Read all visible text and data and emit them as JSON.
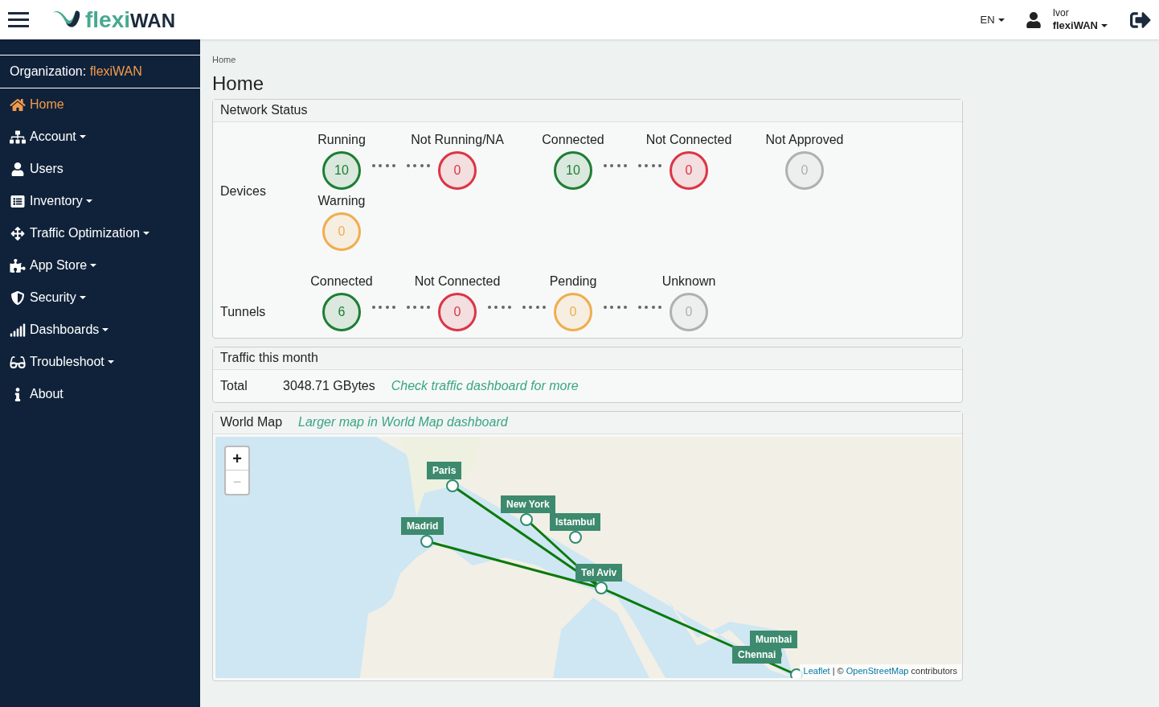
{
  "header": {
    "logo": {
      "part1": "flexi",
      "part2": "WAN"
    },
    "language": "EN",
    "user": {
      "name": "Ivor",
      "organization": "flexiWAN"
    }
  },
  "sidebar": {
    "organization_label": "Organization:",
    "organization": "flexiWAN",
    "items": [
      {
        "label": "Home",
        "selected": true,
        "dropdown": false
      },
      {
        "label": "Account",
        "selected": false,
        "dropdown": true
      },
      {
        "label": "Users",
        "selected": false,
        "dropdown": false
      },
      {
        "label": "Inventory",
        "selected": false,
        "dropdown": true
      },
      {
        "label": "Traffic Optimization",
        "selected": false,
        "dropdown": true
      },
      {
        "label": "App Store",
        "selected": false,
        "dropdown": true
      },
      {
        "label": "Security",
        "selected": false,
        "dropdown": true
      },
      {
        "label": "Dashboards",
        "selected": false,
        "dropdown": true
      },
      {
        "label": "Troubleshoot",
        "selected": false,
        "dropdown": true
      },
      {
        "label": "About",
        "selected": false,
        "dropdown": false
      }
    ]
  },
  "breadcrumb": "Home",
  "page_title": "Home",
  "network_status": {
    "title": "Network Status",
    "groups": [
      {
        "label": "Devices",
        "items": [
          {
            "label": "Running",
            "value": "10",
            "color": "#1e7e34",
            "link_next": true
          },
          {
            "label": "Not Running/NA",
            "value": "0",
            "color": "#dc3545",
            "link_next": false
          },
          {
            "label": "Connected",
            "value": "10",
            "color": "#1e7e34",
            "link_next": true
          },
          {
            "label": "Not Connected",
            "value": "0",
            "color": "#dc3545",
            "link_next": false
          },
          {
            "label": "Not Approved",
            "value": "0",
            "color": "#b0b0b0",
            "link_next": false
          },
          {
            "label": "Warning",
            "value": "0",
            "color": "#f0ad4e",
            "link_next": false
          }
        ]
      },
      {
        "label": "Tunnels",
        "items": [
          {
            "label": "Connected",
            "value": "6",
            "color": "#1e7e34",
            "link_next": true
          },
          {
            "label": "Not Connected",
            "value": "0",
            "color": "#dc3545",
            "link_next": true
          },
          {
            "label": "Pending",
            "value": "0",
            "color": "#f0ad4e",
            "link_next": true
          },
          {
            "label": "Unknown",
            "value": "0",
            "color": "#b0b0b0",
            "link_next": false
          }
        ]
      }
    ]
  },
  "traffic": {
    "title": "Traffic this month",
    "label": "Total",
    "value": "3048.71 GBytes",
    "link": "Check traffic dashboard for more"
  },
  "world_map": {
    "title": "World Map",
    "link": "Larger map in World Map dashboard",
    "zoom_in": "+",
    "zoom_out": "−",
    "sites": [
      {
        "name": "Paris"
      },
      {
        "name": "New York"
      },
      {
        "name": "Madrid"
      },
      {
        "name": "Istambul"
      },
      {
        "name": "Tel Aviv"
      },
      {
        "name": "Mumbai"
      },
      {
        "name": "Chennai"
      }
    ],
    "attribution": {
      "leaflet": "Leaflet",
      "separator": "| ©",
      "osm": "OpenStreetMap",
      "suffix": "contributors"
    }
  }
}
